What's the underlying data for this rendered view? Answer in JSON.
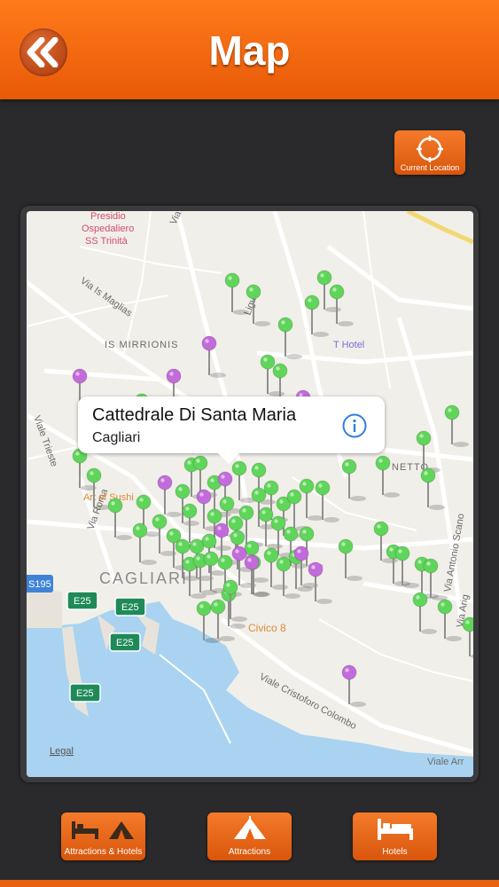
{
  "header": {
    "title": "Map",
    "back_icon": "double-chevron-left-icon"
  },
  "location_button": {
    "label": "Current Location",
    "icon": "crosshair-icon"
  },
  "map": {
    "labels": {
      "poi_1": "Presidio",
      "poi_2": "Ospedaliero",
      "poi_3": "SS Trinità",
      "street_1": "Via Is Maglias",
      "district_1": "IS MIRRIONIS",
      "hotel": "T Hotel",
      "street_2": "Viale Trieste",
      "street_3": "Via Roma",
      "poi_4": "Art of Sushi",
      "city": "CAGLIARI",
      "route_1": "S195",
      "route_2": "E25",
      "route_3": "E25",
      "route_4": "E25",
      "route_5": "E25",
      "poi_5": "Civico 8",
      "street_4": "Viale Cristoforo Colombo",
      "street_5": "Via Antonio Scano",
      "street_6": "Viale Arr",
      "district_2": "NETTO",
      "legal": "Legal",
      "street_7": "Via",
      "street_8": "Ligur",
      "street_9": "Via Arig"
    },
    "callout": {
      "title": "Cattedrale Di Santa Maria",
      "subtitle": "Cagliari",
      "icon": "info-icon"
    },
    "pin_colors": {
      "attraction": "#5fd65a",
      "hotel": "#c36bdc"
    }
  },
  "bottom_nav": [
    {
      "label": "Attractions & Hotels",
      "icon": "bed-and-tent-icon"
    },
    {
      "label": "Attractions",
      "icon": "tent-icon"
    },
    {
      "label": "Hotels",
      "icon": "bed-icon"
    }
  ]
}
